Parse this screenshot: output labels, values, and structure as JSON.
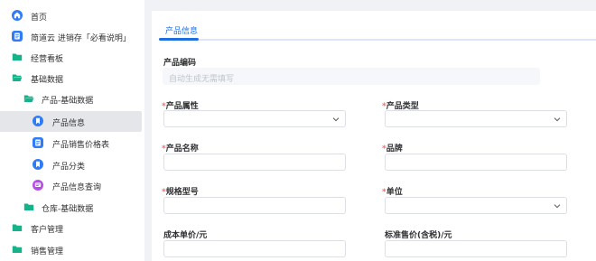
{
  "sidebar": {
    "items": [
      {
        "label": "首页",
        "icon": "home-icon"
      },
      {
        "label": "简道云 进销存「必看说明」",
        "icon": "document-icon"
      },
      {
        "label": "经营看板",
        "icon": "folder-icon"
      },
      {
        "label": "基础数据",
        "icon": "folder-open-icon"
      },
      {
        "label": "产品-基础数据",
        "icon": "folder-open-icon"
      },
      {
        "label": "产品信息",
        "icon": "bookmark-icon"
      },
      {
        "label": "产品销售价格表",
        "icon": "document-icon"
      },
      {
        "label": "产品分类",
        "icon": "bookmark-icon"
      },
      {
        "label": "产品信息查询",
        "icon": "message-icon"
      },
      {
        "label": "仓库-基础数据",
        "icon": "folder-icon"
      },
      {
        "label": "客户管理",
        "icon": "folder-icon"
      },
      {
        "label": "销售管理",
        "icon": "folder-icon"
      }
    ],
    "active_index": 5
  },
  "main": {
    "tab_label": "产品信息",
    "product_code": {
      "label": "产品编码",
      "placeholder": "自动生成无需填写"
    },
    "fields": {
      "attribute": {
        "label": "产品属性",
        "required": "*"
      },
      "type": {
        "label": "产品类型",
        "required": "*"
      },
      "name": {
        "label": "产品名称",
        "required": "*"
      },
      "brand": {
        "label": "品牌",
        "required": "*"
      },
      "spec": {
        "label": "规格型号",
        "required": "*"
      },
      "unit": {
        "label": "单位",
        "required": "*"
      },
      "cost_price": {
        "label": "成本单价/元"
      },
      "std_price": {
        "label": "标准售价(含税)/元"
      }
    }
  },
  "colors": {
    "accent": "#1f6fe0",
    "folder": "#16b38a",
    "required": "#f56c6c"
  }
}
